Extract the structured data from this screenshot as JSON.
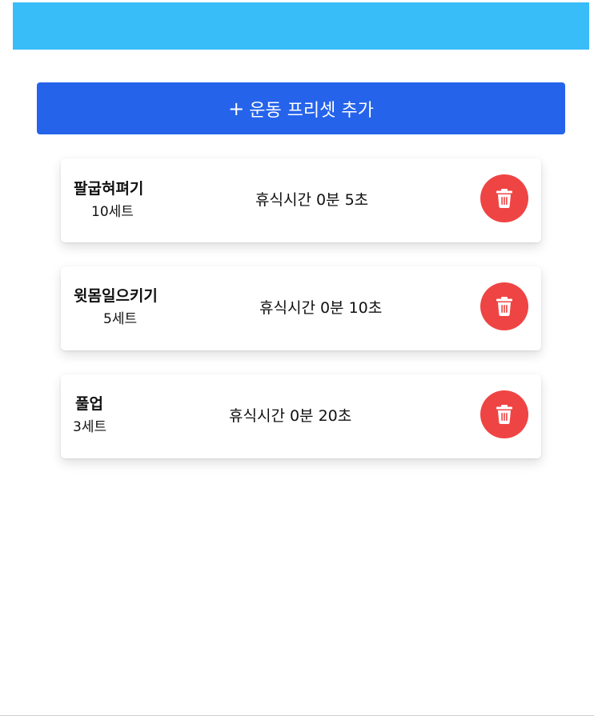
{
  "toolbar": {
    "add_button_icon": "plus-icon",
    "add_button_plus": "+",
    "add_button_label": "운동 프리셋 추가"
  },
  "colors": {
    "top_bar": "#38bdf8",
    "add_button": "#2563eb",
    "delete_button": "#ef4444"
  },
  "presets": [
    {
      "name": "팔굽혀펴기",
      "sets": "10세트",
      "rest": "휴식시간 0분 5초",
      "delete_icon": "trash-icon"
    },
    {
      "name": "윗몸일으키기",
      "sets": "5세트",
      "rest": "휴식시간 0분 10초",
      "delete_icon": "trash-icon"
    },
    {
      "name": "풀업",
      "sets": "3세트",
      "rest": "휴식시간 0분 20초",
      "delete_icon": "trash-icon"
    }
  ]
}
